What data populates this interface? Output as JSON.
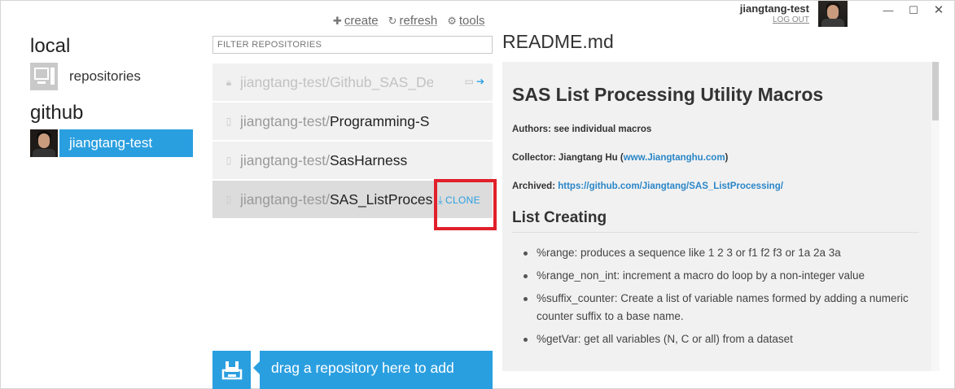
{
  "toolbar": {
    "create": "create",
    "refresh": "refresh",
    "tools": "tools"
  },
  "account": {
    "username": "jiangtang-test",
    "logout": "LOG OUT"
  },
  "sidebar": {
    "local_title": "local",
    "local_items": [
      {
        "label": "repositories"
      }
    ],
    "github_title": "github",
    "github_items": [
      {
        "label": "jiangtang-test"
      }
    ]
  },
  "repo_list": {
    "filter_placeholder": "FILTER REPOSITORIES",
    "repos": [
      {
        "owner": "jiangtang-test/",
        "name": "Github_SAS_Demo"
      },
      {
        "owner": "jiangtang-test/",
        "name": "Programming-S"
      },
      {
        "owner": "jiangtang-test/",
        "name": "SasHarness"
      },
      {
        "owner": "jiangtang-test/",
        "name": "SAS_ListProces"
      }
    ],
    "clone_label": "CLONE",
    "drop_text": "drag a repository here to add"
  },
  "readme": {
    "title": "README.md",
    "h1": "SAS List Processing Utility Macros",
    "authors": "Authors: see individual macros",
    "collector_prefix": "Collector: Jiangtang Hu (",
    "collector_link": "www.Jiangtanghu.com",
    "collector_suffix": ")",
    "archived_prefix": "Archived: ",
    "archived_link": "https://github.com/Jiangtang/SAS_ListProcessing/",
    "h2": "List Creating",
    "bullets": [
      "%range: produces a sequence like 1 2 3 or f1 f2 f3 or 1a 2a 3a",
      "%range_non_int: increment a macro do loop by a non-integer value",
      "%suffix_counter: Create a list of variable names formed by adding a numeric counter suffix to a base name.",
      "%getVar: get all variables (N, C or all) from a dataset"
    ]
  },
  "colors": {
    "accent": "#2a9fe0",
    "highlight_box": "#e0202a",
    "panel_bg": "#f1f1f1"
  }
}
